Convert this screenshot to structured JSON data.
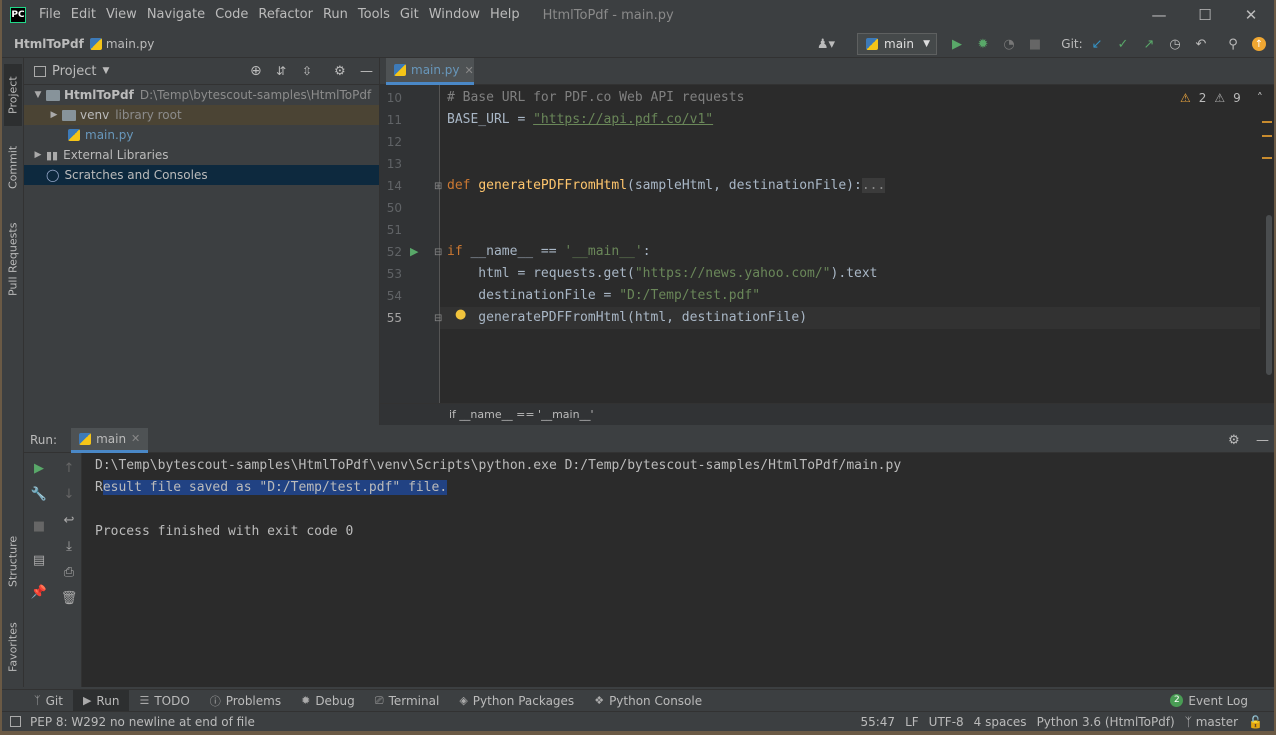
{
  "app": {
    "logo_text": "PC",
    "window_title": "HtmlToPdf - main.py",
    "menu": [
      "File",
      "Edit",
      "View",
      "Navigate",
      "Code",
      "Refactor",
      "Run",
      "Tools",
      "Git",
      "Window",
      "Help"
    ]
  },
  "navbar": {
    "project": "HtmlToPdf",
    "file": "main.py",
    "run_config": "main",
    "git_label": "Git:"
  },
  "side_tabs": {
    "project": "Project",
    "commit": "Commit",
    "pull_requests": "Pull Requests",
    "structure": "Structure",
    "favorites": "Favorites"
  },
  "project_panel": {
    "title": "Project",
    "root_name": "HtmlToPdf",
    "root_path": "D:\\Temp\\bytescout-samples\\HtmlToPdf",
    "venv": "venv",
    "venv_hint": "library root",
    "file": "main.py",
    "external": "External Libraries",
    "scratches": "Scratches and Consoles"
  },
  "editor": {
    "tab": "main.py",
    "warnings": "2",
    "weak_warnings": "9",
    "line_numbers": [
      "10",
      "11",
      "12",
      "13",
      "14",
      "50",
      "51",
      "52",
      "53",
      "54",
      "55"
    ],
    "lines": {
      "l10_comment": "# Base URL for PDF.co Web API requests",
      "l11_var": "BASE_URL = ",
      "l11_str": "\"https://api.pdf.co/v1\"",
      "l14_kw": "def ",
      "l14_fn": "generatePDFFromHtml",
      "l14_args": "(sampleHtml, destinationFile):",
      "l14_fold": "...",
      "l52_kw": "if ",
      "l52_rest": "__name__ == ",
      "l52_str": "'__main__'",
      "l52_colon": ":",
      "l53_a": "    html = requests.get(",
      "l53_str": "\"https://news.yahoo.com/\"",
      "l53_b": ").text",
      "l54_a": "    destinationFile = ",
      "l54_str": "\"D:/Temp/test.pdf\"",
      "l55": "    generatePDFFromHtml(html, destinationFile)"
    },
    "breadcrumb": "if __name__ == '__main__'"
  },
  "run_panel": {
    "label": "Run:",
    "tab": "main",
    "output": [
      "D:\\Temp\\bytescout-samples\\HtmlToPdf\\venv\\Scripts\\python.exe D:/Temp/bytescout-samples/HtmlToPdf/main.py",
      "R",
      "esult file saved as \"D:/Temp/test.pdf\" file.",
      "Process finished with exit code 0"
    ]
  },
  "tool_tabs": [
    "Git",
    "Run",
    "TODO",
    "Problems",
    "Debug",
    "Terminal",
    "Python Packages",
    "Python Console"
  ],
  "event_log": {
    "count": "2",
    "label": "Event Log"
  },
  "status_bar": {
    "message": "PEP 8: W292 no newline at end of file",
    "position": "55:47",
    "line_sep": "LF",
    "encoding": "UTF-8",
    "indent": "4 spaces",
    "interpreter": "Python 3.6 (HtmlToPdf)",
    "branch": "master"
  }
}
